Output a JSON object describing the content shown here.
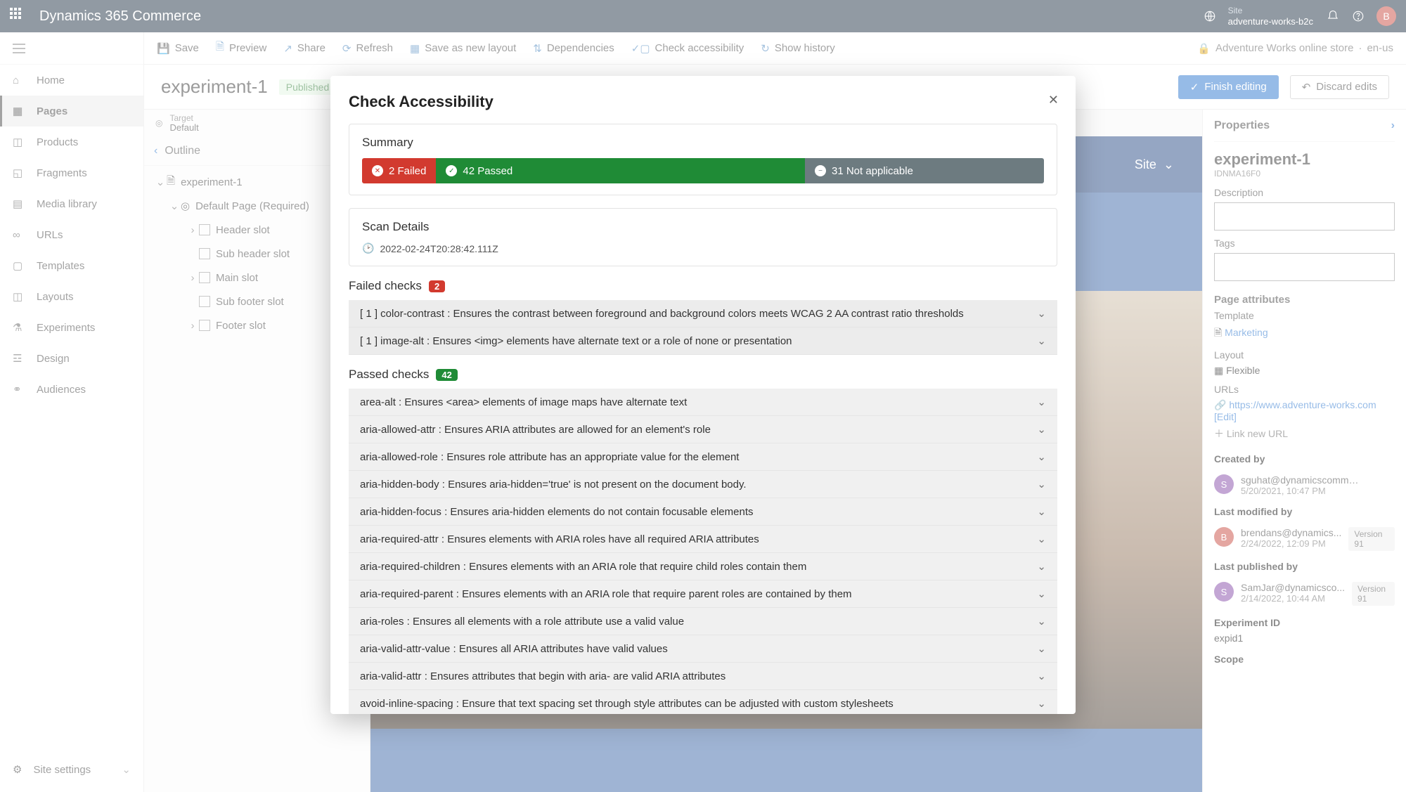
{
  "app": {
    "brand": "Dynamics 365 Commerce",
    "siteLabel": "Site",
    "siteName": "adventure-works-b2c",
    "avatar": "B"
  },
  "commands": {
    "save": "Save",
    "preview": "Preview",
    "share": "Share",
    "refresh": "Refresh",
    "saveLayout": "Save as new layout",
    "dependencies": "Dependencies",
    "checkA11y": "Check accessibility",
    "history": "Show history",
    "storeName": "Adventure Works online store",
    "locale": "en-us"
  },
  "rail": {
    "items": [
      {
        "label": "Home"
      },
      {
        "label": "Pages"
      },
      {
        "label": "Products"
      },
      {
        "label": "Fragments"
      },
      {
        "label": "Media library"
      },
      {
        "label": "URLs"
      },
      {
        "label": "Templates"
      },
      {
        "label": "Layouts"
      },
      {
        "label": "Experiments"
      },
      {
        "label": "Design"
      },
      {
        "label": "Audiences"
      }
    ],
    "settings": "Site settings"
  },
  "page": {
    "title": "experiment-1",
    "status": "Published",
    "finish": "Finish editing",
    "discard": "Discard edits",
    "targetLabel": "Target",
    "targetValue": "Default"
  },
  "outline": {
    "title": "Outline",
    "root": "experiment-1",
    "defaultPage": "Default Page (Required)",
    "slots": [
      {
        "label": "Header slot",
        "expand": true
      },
      {
        "label": "Sub header slot",
        "expand": false
      },
      {
        "label": "Main slot",
        "expand": true
      },
      {
        "label": "Sub footer slot",
        "expand": false
      },
      {
        "label": "Footer slot",
        "expand": true
      }
    ]
  },
  "canvas": {
    "siteBtn": "Site"
  },
  "props": {
    "title": "Properties",
    "name": "experiment-1",
    "id": "IDNMA16F0",
    "descLabel": "Description",
    "tagsLabel": "Tags",
    "attrsTitle": "Page attributes",
    "templateLabel": "Template",
    "templateValue": "Marketing",
    "layoutLabel": "Layout",
    "layoutValue": "Flexible",
    "urlsLabel": "URLs",
    "urlValue": "https://www.adventure-works.com",
    "urlEdit": "[Edit]",
    "linkNew": "Link new URL",
    "createdLabel": "Created by",
    "createdWho": "sguhat@dynamicscommercetria...",
    "createdWhen": "5/20/2021, 10:47 PM",
    "createdInitial": "S",
    "modifiedLabel": "Last modified by",
    "modifiedWho": "brendans@dynamics...",
    "modifiedWhen": "2/24/2022, 12:09 PM",
    "modifiedInitial": "B",
    "modifiedVer": "Version 91",
    "publishedLabel": "Last published by",
    "publishedWho": "SamJar@dynamicsco...",
    "publishedWhen": "2/14/2022, 10:44 AM",
    "publishedInitial": "S",
    "publishedVer": "Version 91",
    "expIdLabel": "Experiment ID",
    "expIdValue": "expid1",
    "scopeLabel": "Scope"
  },
  "modal": {
    "title": "Check Accessibility",
    "summaryTitle": "Summary",
    "failText": "2 Failed",
    "passText": "42 Passed",
    "naText": "31 Not applicable",
    "scanTitle": "Scan Details",
    "scanTime": "2022-02-24T20:28:42.111Z",
    "failedTitle": "Failed checks",
    "failedCount": "2",
    "failedChecks": [
      "[ 1 ] color-contrast : Ensures the contrast between foreground and background colors meets WCAG 2 AA contrast ratio thresholds",
      "[ 1 ] image-alt : Ensures <img> elements have alternate text or a role of none or presentation"
    ],
    "passedTitle": "Passed checks",
    "passedCount": "42",
    "passedChecks": [
      "area-alt : Ensures <area> elements of image maps have alternate text",
      "aria-allowed-attr : Ensures ARIA attributes are allowed for an element's role",
      "aria-allowed-role : Ensures role attribute has an appropriate value for the element",
      "aria-hidden-body : Ensures aria-hidden='true' is not present on the document body.",
      "aria-hidden-focus : Ensures aria-hidden elements do not contain focusable elements",
      "aria-required-attr : Ensures elements with ARIA roles have all required ARIA attributes",
      "aria-required-children : Ensures elements with an ARIA role that require child roles contain them",
      "aria-required-parent : Ensures elements with an ARIA role that require parent roles are contained by them",
      "aria-roles : Ensures all elements with a role attribute use a valid value",
      "aria-valid-attr-value : Ensures all ARIA attributes have valid values",
      "aria-valid-attr : Ensures attributes that begin with aria- are valid ARIA attributes",
      "avoid-inline-spacing : Ensure that text spacing set through style attributes can be adjusted with custom stylesheets"
    ]
  }
}
